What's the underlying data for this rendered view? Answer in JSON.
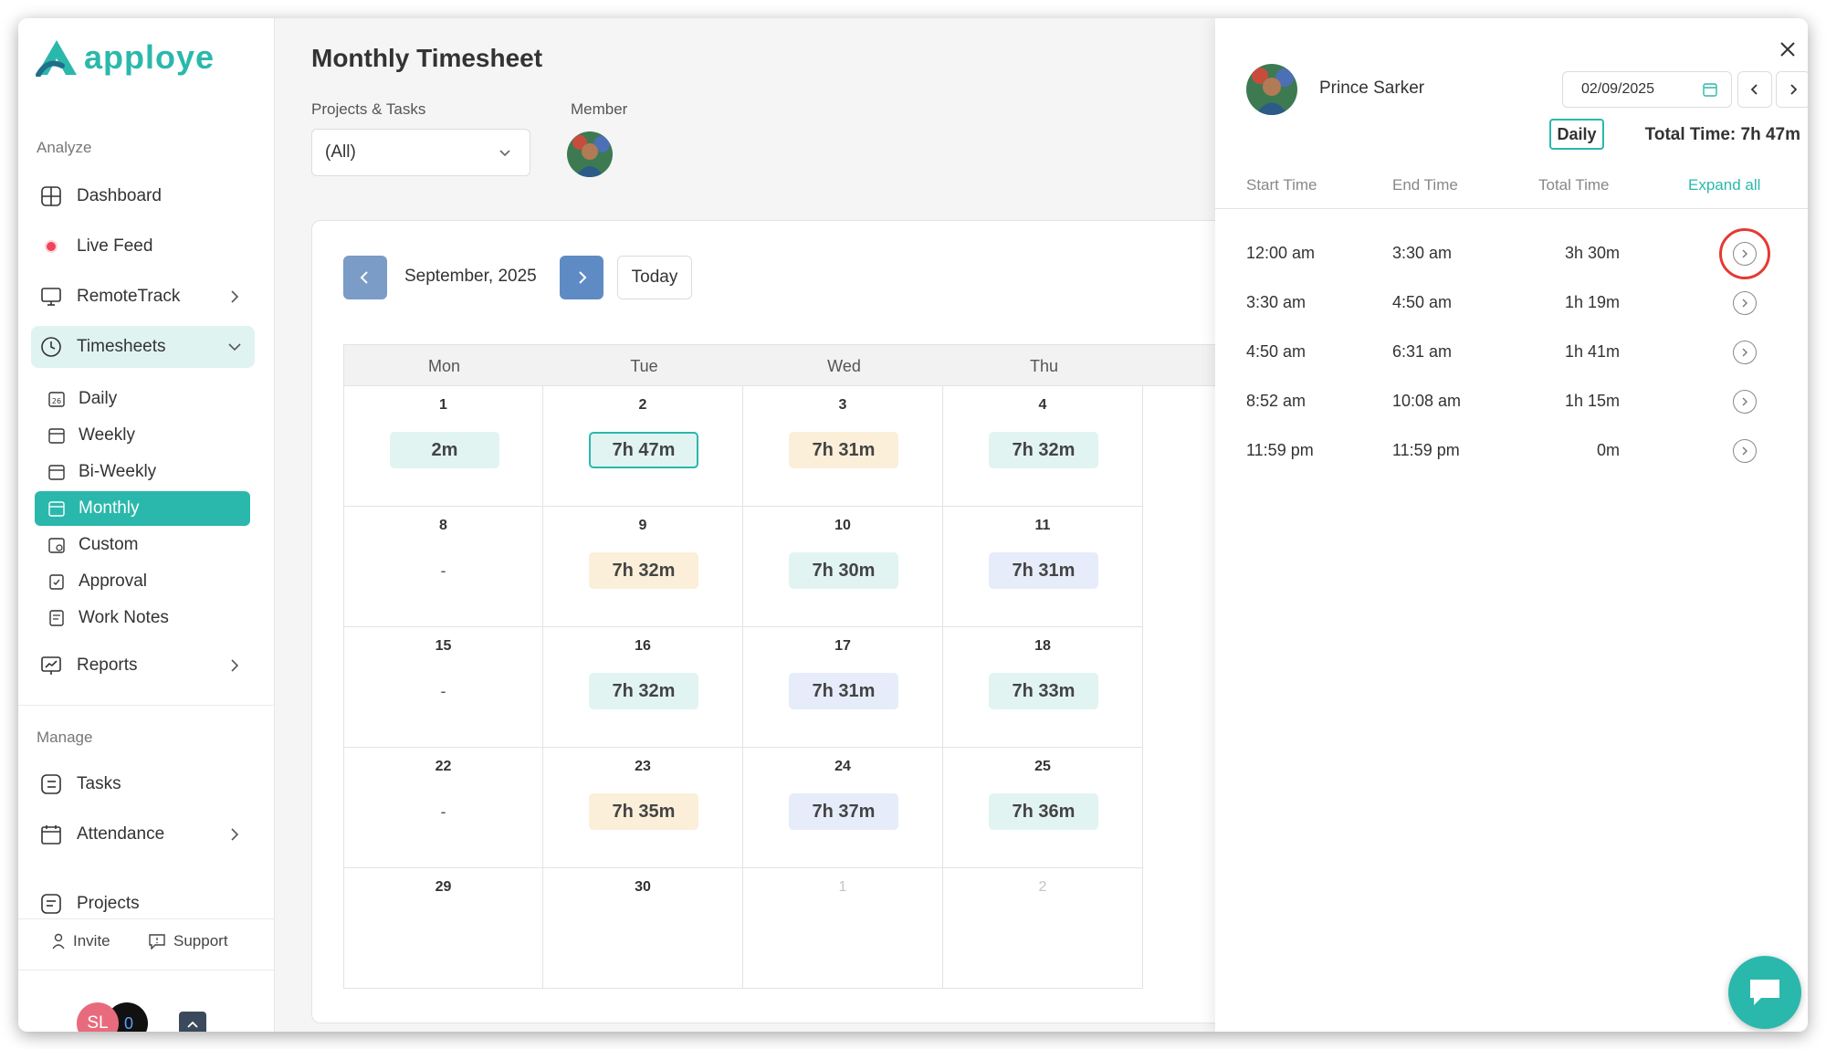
{
  "app": {
    "brand": "apploye",
    "brand_color": "#2bb8ac"
  },
  "sidebar": {
    "analyze_label": "Analyze",
    "manage_label": "Manage",
    "items": [
      {
        "label": "Dashboard",
        "icon": "dashboard-grid-icon"
      },
      {
        "label": "Live Feed",
        "icon": "live-dot-icon"
      },
      {
        "label": "RemoteTrack",
        "icon": "monitor-icon"
      },
      {
        "label": "Timesheets",
        "icon": "clock-icon"
      },
      {
        "label": "Reports",
        "icon": "chart-icon"
      },
      {
        "label": "Tasks",
        "icon": "tasks-icon"
      },
      {
        "label": "Attendance",
        "icon": "calendar-check-icon"
      },
      {
        "label": "Projects",
        "icon": "projects-icon"
      }
    ],
    "timesheet_sub": [
      {
        "label": "Daily",
        "icon": "calendar-day-icon"
      },
      {
        "label": "Weekly",
        "icon": "calendar-icon"
      },
      {
        "label": "Bi-Weekly",
        "icon": "calendar-icon"
      },
      {
        "label": "Monthly",
        "icon": "calendar-icon",
        "active": true
      },
      {
        "label": "Custom",
        "icon": "calendar-custom-icon"
      },
      {
        "label": "Approval",
        "icon": "approval-icon"
      },
      {
        "label": "Work Notes",
        "icon": "notes-icon"
      }
    ],
    "footer": {
      "invite": "Invite",
      "support": "Support",
      "initials": "SL",
      "badge": "0"
    }
  },
  "main": {
    "title": "Monthly Timesheet",
    "projects_label": "Projects & Tasks",
    "projects_value": "(All)",
    "member_label": "Member",
    "calendar": {
      "month": "September, 2025",
      "today": "Today",
      "weekdays": [
        "Mon",
        "Tue",
        "Wed",
        "Thu"
      ],
      "weeks": [
        [
          {
            "day": "1",
            "time": "2m",
            "tone": "teal"
          },
          {
            "day": "2",
            "time": "7h 47m",
            "tone": "selected"
          },
          {
            "day": "3",
            "time": "7h 31m",
            "tone": "beige"
          },
          {
            "day": "4",
            "time": "7h 32m",
            "tone": "teal"
          }
        ],
        [
          {
            "day": "8",
            "time": "-",
            "tone": "none"
          },
          {
            "day": "9",
            "time": "7h 32m",
            "tone": "beige"
          },
          {
            "day": "10",
            "time": "7h 30m",
            "tone": "teal"
          },
          {
            "day": "11",
            "time": "7h 31m",
            "tone": "blue"
          }
        ],
        [
          {
            "day": "15",
            "time": "-",
            "tone": "none"
          },
          {
            "day": "16",
            "time": "7h 32m",
            "tone": "teal"
          },
          {
            "day": "17",
            "time": "7h 31m",
            "tone": "blue"
          },
          {
            "day": "18",
            "time": "7h 33m",
            "tone": "teal"
          }
        ],
        [
          {
            "day": "22",
            "time": "-",
            "tone": "none"
          },
          {
            "day": "23",
            "time": "7h 35m",
            "tone": "beige"
          },
          {
            "day": "24",
            "time": "7h 37m",
            "tone": "blue"
          },
          {
            "day": "25",
            "time": "7h 36m",
            "tone": "teal"
          }
        ],
        [
          {
            "day": "29",
            "time": "",
            "tone": "empty"
          },
          {
            "day": "30",
            "time": "",
            "tone": "empty"
          },
          {
            "day": "1",
            "time": "",
            "tone": "muted"
          },
          {
            "day": "2",
            "time": "",
            "tone": "muted"
          }
        ]
      ]
    }
  },
  "panel": {
    "name": "Prince Sarker",
    "date": "02/09/2025",
    "mode": "Daily",
    "total_time": "Total Time: 7h 47m",
    "headers": {
      "start": "Start Time",
      "end": "End Time",
      "total": "Total Time",
      "expand": "Expand all"
    },
    "rows": [
      {
        "start": "12:00 am",
        "end": "3:30 am",
        "total": "3h 30m",
        "highlighted": true
      },
      {
        "start": "3:30 am",
        "end": "4:50 am",
        "total": "1h 19m"
      },
      {
        "start": "4:50 am",
        "end": "6:31 am",
        "total": "1h 41m"
      },
      {
        "start": "8:52 am",
        "end": "10:08 am",
        "total": "1h 15m"
      },
      {
        "start": "11:59 pm",
        "end": "11:59 pm",
        "total": "0m"
      }
    ]
  }
}
